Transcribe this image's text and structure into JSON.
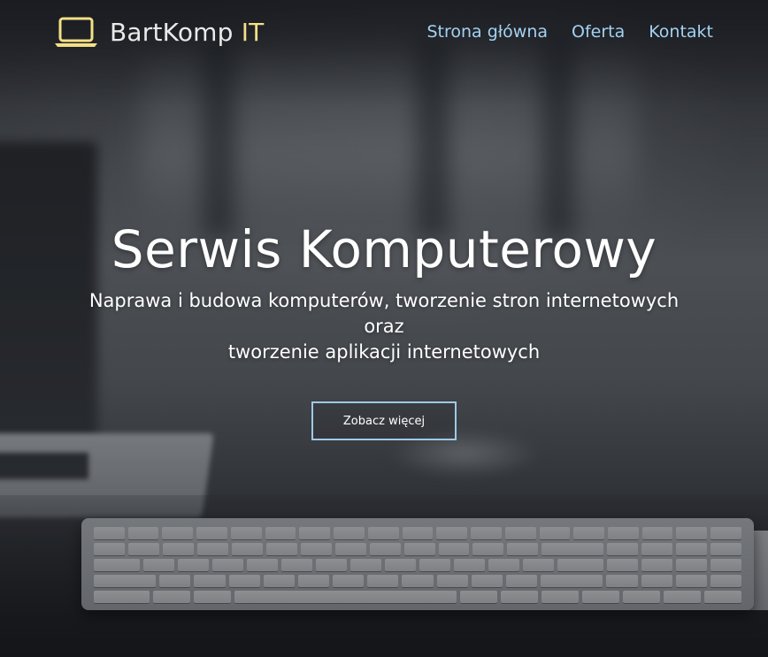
{
  "brand": {
    "name": "BartKomp",
    "suffix": "IT",
    "icon": "laptop-icon",
    "icon_color": "#f3df86"
  },
  "nav": {
    "items": [
      {
        "label": "Strona główna"
      },
      {
        "label": "Oferta"
      },
      {
        "label": "Kontakt"
      }
    ],
    "color": "#a3d2f2"
  },
  "hero": {
    "title": "Serwis Komputerowy",
    "subtitle_lines": [
      "Naprawa i budowa komputerów, tworzenie stron internetowych",
      "oraz",
      "tworzenie aplikacji internetowych"
    ],
    "cta_label": "Zobacz więcej",
    "cta_border_color": "#9fc9e6"
  },
  "background": {
    "description_icon": "keyboard-image"
  }
}
